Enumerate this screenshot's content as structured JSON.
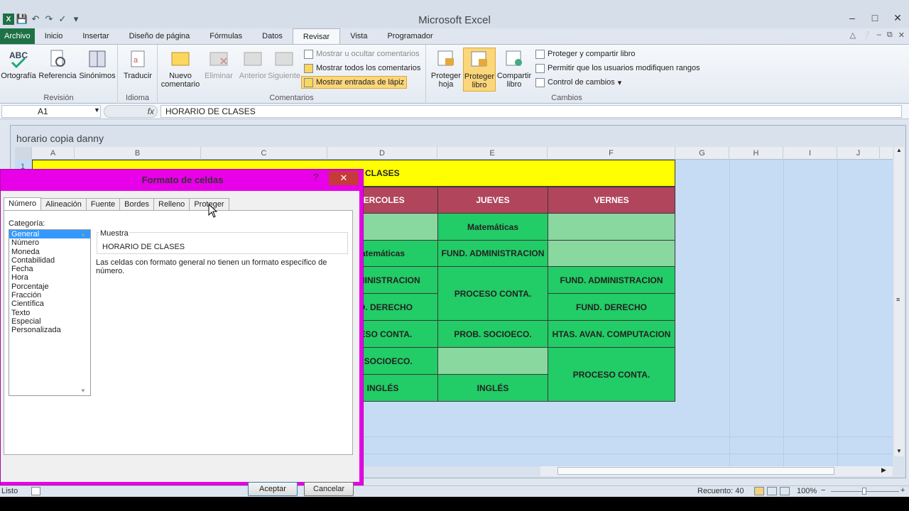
{
  "window_title": "Microsoft Excel",
  "quick_access": [
    "save-icon",
    "undo-icon",
    "redo-icon",
    "check-icon",
    "customize-icon"
  ],
  "tabs": [
    "Archivo",
    "Inicio",
    "Insertar",
    "Diseño de página",
    "Fórmulas",
    "Datos",
    "Revisar",
    "Vista",
    "Programador"
  ],
  "ribbon": {
    "groups": {
      "revision": "Revisión",
      "idioma": "Idioma",
      "comentarios": "Comentarios",
      "cambios": "Cambios"
    },
    "ortografia": "Ortografía",
    "referencia": "Referencia",
    "sinonimos": "Sinónimos",
    "traducir": "Traducir",
    "nuevo_comentario": "Nuevo\ncomentario",
    "eliminar": "Eliminar",
    "anterior": "Anterior",
    "siguiente": "Siguiente",
    "mostrar_ocultar": "Mostrar u ocultar comentarios",
    "mostrar_todos": "Mostrar todos los comentarios",
    "mostrar_lapiz": "Mostrar entradas de lápiz",
    "proteger_hoja": "Proteger\nhoja",
    "proteger_libro": "Proteger\nlibro",
    "compartir_libro": "Compartir\nlibro",
    "proteger_compartir": "Proteger y compartir libro",
    "permitir": "Permitir que los usuarios modifiquen rangos",
    "control_cambios": "Control de cambios"
  },
  "formula_bar": {
    "namebox": "A1",
    "fx": "fx",
    "content": "HORARIO DE CLASES"
  },
  "workbook": {
    "title": "horario copia danny",
    "row1": "1"
  },
  "columns": [
    "A",
    "B",
    "C",
    "D",
    "E",
    "F",
    "G",
    "H",
    "I",
    "J"
  ],
  "schedule": {
    "title_fragment": "CLASES",
    "headers": [
      "IERCOLES",
      "JUEVES",
      "VERNES"
    ],
    "cells": {
      "d1": "",
      "e1": "Matemáticas",
      "f1": "",
      "d2": "atemáticas",
      "e2": "FUND. ADMINISTRACION",
      "f2": "",
      "d3": "ADMINISTRACION",
      "e34": "PROCESO CONTA.",
      "f3": "FUND. ADMINISTRACION",
      "d4": "ND. DERECHO",
      "f4": "FUND. DERECHO",
      "d5": "CESO CONTA.",
      "e5": "PROB. SOCIOECO.",
      "f5": "HTAS. AVAN. COMPUTACION",
      "d6": "B. SOCIOECO.",
      "e6": "",
      "f67": "PROCESO CONTA.",
      "d7": "INGLÉS",
      "e7": "INGLÉS"
    }
  },
  "status": {
    "ready": "Listo",
    "count": "Recuento: 40",
    "zoom": "100%"
  },
  "dialog": {
    "title": "Formato de celdas",
    "help": "?",
    "close": "✕",
    "tabs": [
      "Número",
      "Alineación",
      "Fuente",
      "Bordes",
      "Relleno",
      "Proteger"
    ],
    "categoria_label": "Categoría:",
    "categories": [
      "General",
      "Número",
      "Moneda",
      "Contabilidad",
      "Fecha",
      "Hora",
      "Porcentaje",
      "Fracción",
      "Científica",
      "Texto",
      "Especial",
      "Personalizada"
    ],
    "muestra_label": "Muestra",
    "muestra_value": "HORARIO DE CLASES",
    "description": "Las celdas con formato general no tienen un formato específico de número.",
    "ok": "Aceptar",
    "cancel": "Cancelar"
  },
  "colors": {
    "yellow": "#ffff00",
    "header_red": "#b0455c",
    "green": "#22cc66",
    "light_green": "#88d8a0",
    "dialog_border": "#e800e8",
    "file_tab": "#1e7145"
  }
}
